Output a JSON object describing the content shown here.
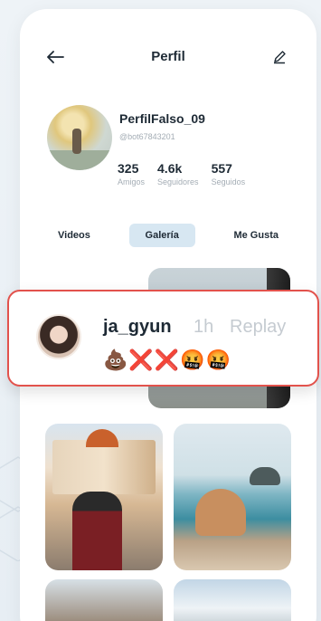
{
  "header": {
    "title": "Perfil",
    "back_icon": "←",
    "edit_icon": "✎"
  },
  "profile": {
    "username": "PerfilFalso_09",
    "handle": "@bot67843201",
    "stats": [
      {
        "value": "325",
        "label": "Amigos"
      },
      {
        "value": "4.6k",
        "label": "Seguidores"
      },
      {
        "value": "557",
        "label": "Seguidos"
      }
    ]
  },
  "tabs": [
    {
      "label": "Videos",
      "active": false
    },
    {
      "label": "Galería",
      "active": true
    },
    {
      "label": "Me Gusta",
      "active": false
    }
  ],
  "notification": {
    "user": "ja_gyun",
    "time": "1h",
    "reply_label": "Replay",
    "message": "💩❌❌🤬🤬"
  },
  "colors": {
    "accent_tab": "#d7e7f2",
    "notification_border": "#e2524c"
  }
}
